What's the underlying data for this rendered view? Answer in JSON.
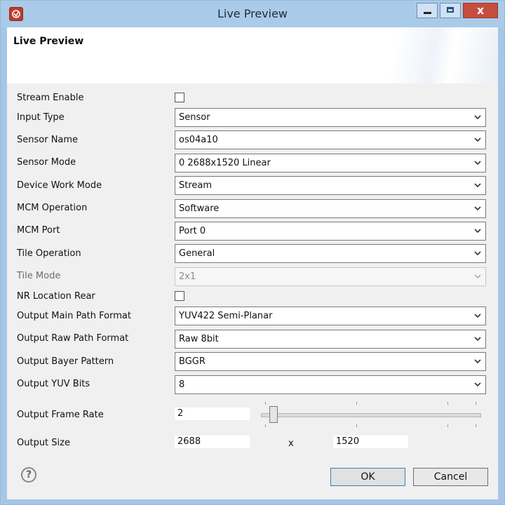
{
  "window": {
    "title": "Live Preview",
    "close_glyph": "x"
  },
  "header": {
    "title": "Live Preview"
  },
  "form": {
    "stream_enable": {
      "label": "Stream Enable",
      "checked": false
    },
    "input_type": {
      "label": "Input Type",
      "value": "Sensor"
    },
    "sensor_name": {
      "label": "Sensor Name",
      "value": "os04a10"
    },
    "sensor_mode": {
      "label": "Sensor Mode",
      "value": "0 2688x1520 Linear"
    },
    "device_work_mode": {
      "label": "Device Work Mode",
      "value": "Stream"
    },
    "mcm_operation": {
      "label": "MCM Operation",
      "value": "Software"
    },
    "mcm_port": {
      "label": "MCM Port",
      "value": "Port 0"
    },
    "tile_operation": {
      "label": "Tile Operation",
      "value": "General"
    },
    "tile_mode": {
      "label": "Tile Mode",
      "value": "2x1",
      "enabled": false
    },
    "nr_location_rear": {
      "label": "NR Location Rear",
      "checked": false
    },
    "output_main_path_format": {
      "label": "Output Main Path Format",
      "value": "YUV422 Semi-Planar"
    },
    "output_raw_path_format": {
      "label": "Output Raw Path Format",
      "value": "Raw 8bit"
    },
    "output_bayer_pattern": {
      "label": "Output Bayer Pattern",
      "value": "BGGR"
    },
    "output_yuv_bits": {
      "label": "Output YUV Bits",
      "value": "8"
    },
    "output_frame_rate": {
      "label": "Output Frame Rate",
      "value": "2"
    },
    "output_size": {
      "label": "Output Size",
      "width": "2688",
      "separator": "x",
      "height": "1520"
    }
  },
  "footer": {
    "help_glyph": "?",
    "ok_label": "OK",
    "cancel_label": "Cancel"
  },
  "icons": {
    "app": "app-icon",
    "minimize": "minimize-icon",
    "maximize": "maximize-icon",
    "close": "close-icon",
    "dropdown": "chevron-down-icon",
    "help": "help-icon"
  },
  "colors": {
    "titlebar": "#a9cbe9",
    "close_button": "#c74d3d",
    "dialog_background": "#f0f0f0",
    "ok_border": "#3c7fb1"
  }
}
